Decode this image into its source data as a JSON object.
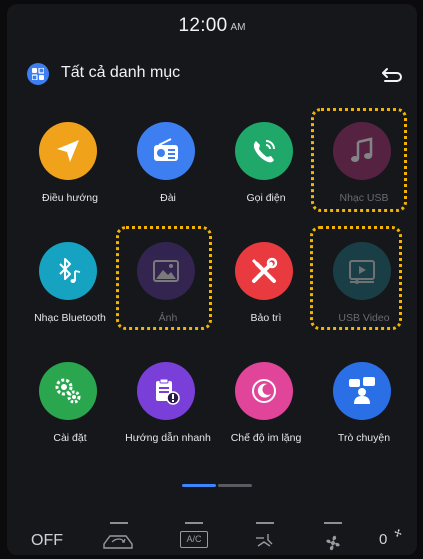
{
  "status": {
    "time": "12:00",
    "ampm": "AM"
  },
  "header": {
    "title": "Tất cả danh mục",
    "category_icon": "grid-icon",
    "back_icon": "back-arrow-icon"
  },
  "apps": [
    {
      "label": "Điều hướng",
      "color": "#f1a21b",
      "icon": "navigation-icon",
      "enabled": true,
      "highlighted": false
    },
    {
      "label": "Đài",
      "color": "#3d7ff0",
      "icon": "radio-icon",
      "enabled": true,
      "highlighted": false
    },
    {
      "label": "Gọi điện",
      "color": "#1fa86a",
      "icon": "phone-icon",
      "enabled": true,
      "highlighted": false
    },
    {
      "label": "Nhạc USB",
      "color": "#8a2b63",
      "icon": "music-note-icon",
      "enabled": false,
      "highlighted": true
    },
    {
      "label": "Nhạc Bluetooth",
      "color": "#15a3c1",
      "icon": "bluetooth-music-icon",
      "enabled": true,
      "highlighted": false
    },
    {
      "label": "Ảnh",
      "color": "#4b2f7c",
      "icon": "image-icon",
      "enabled": false,
      "highlighted": true
    },
    {
      "label": "Bảo trì",
      "color": "#e83a3f",
      "icon": "tools-icon",
      "enabled": true,
      "highlighted": false
    },
    {
      "label": "USB Video",
      "color": "#1f5f68",
      "icon": "video-icon",
      "enabled": false,
      "highlighted": true
    },
    {
      "label": "Cài đặt",
      "color": "#2aa64f",
      "icon": "settings-gears-icon",
      "enabled": true,
      "highlighted": false
    },
    {
      "label": "Hướng dẫn nhanh",
      "color": "#7a3fd9",
      "icon": "quick-guide-icon",
      "enabled": true,
      "highlighted": false
    },
    {
      "label": "Chế độ im lặng",
      "color": "#e0459a",
      "icon": "silent-mode-icon",
      "enabled": true,
      "highlighted": false
    },
    {
      "label": "Trò chuyện",
      "color": "#2b6fe6",
      "icon": "chat-icon",
      "enabled": true,
      "highlighted": false
    }
  ],
  "pager": {
    "pages": 2,
    "current": 1
  },
  "climate": {
    "off_label": "OFF",
    "ac_label": "A/C",
    "fan_speed": "0",
    "icons": [
      "recirculation-icon",
      "ac-icon",
      "airflow-icon",
      "fan-icon"
    ]
  }
}
